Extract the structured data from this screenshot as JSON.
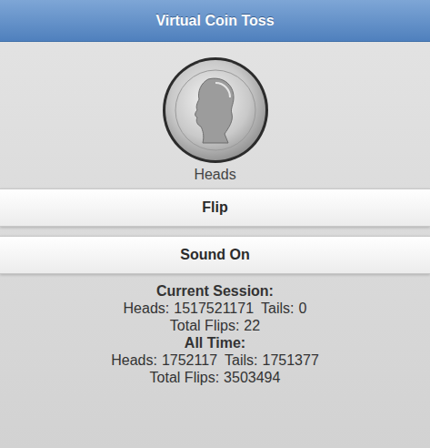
{
  "header": {
    "title": "Virtual Coin Toss"
  },
  "coin": {
    "face": "Heads"
  },
  "buttons": [
    {
      "label": "Flip"
    },
    {
      "label": "Sound On"
    }
  ],
  "current_session": {
    "title": "Current Session:",
    "heads_label": "Heads:",
    "heads": "1517521171",
    "tails_label": "Tails:",
    "tails": "0",
    "total_label": "Total Flips:",
    "total": "22"
  },
  "all_time": {
    "title": "All Time:",
    "heads_label": "Heads:",
    "heads": "1752117",
    "tails_label": "Tails:",
    "tails": "1751377",
    "total_label": "Total Flips:",
    "total": "3503494"
  }
}
